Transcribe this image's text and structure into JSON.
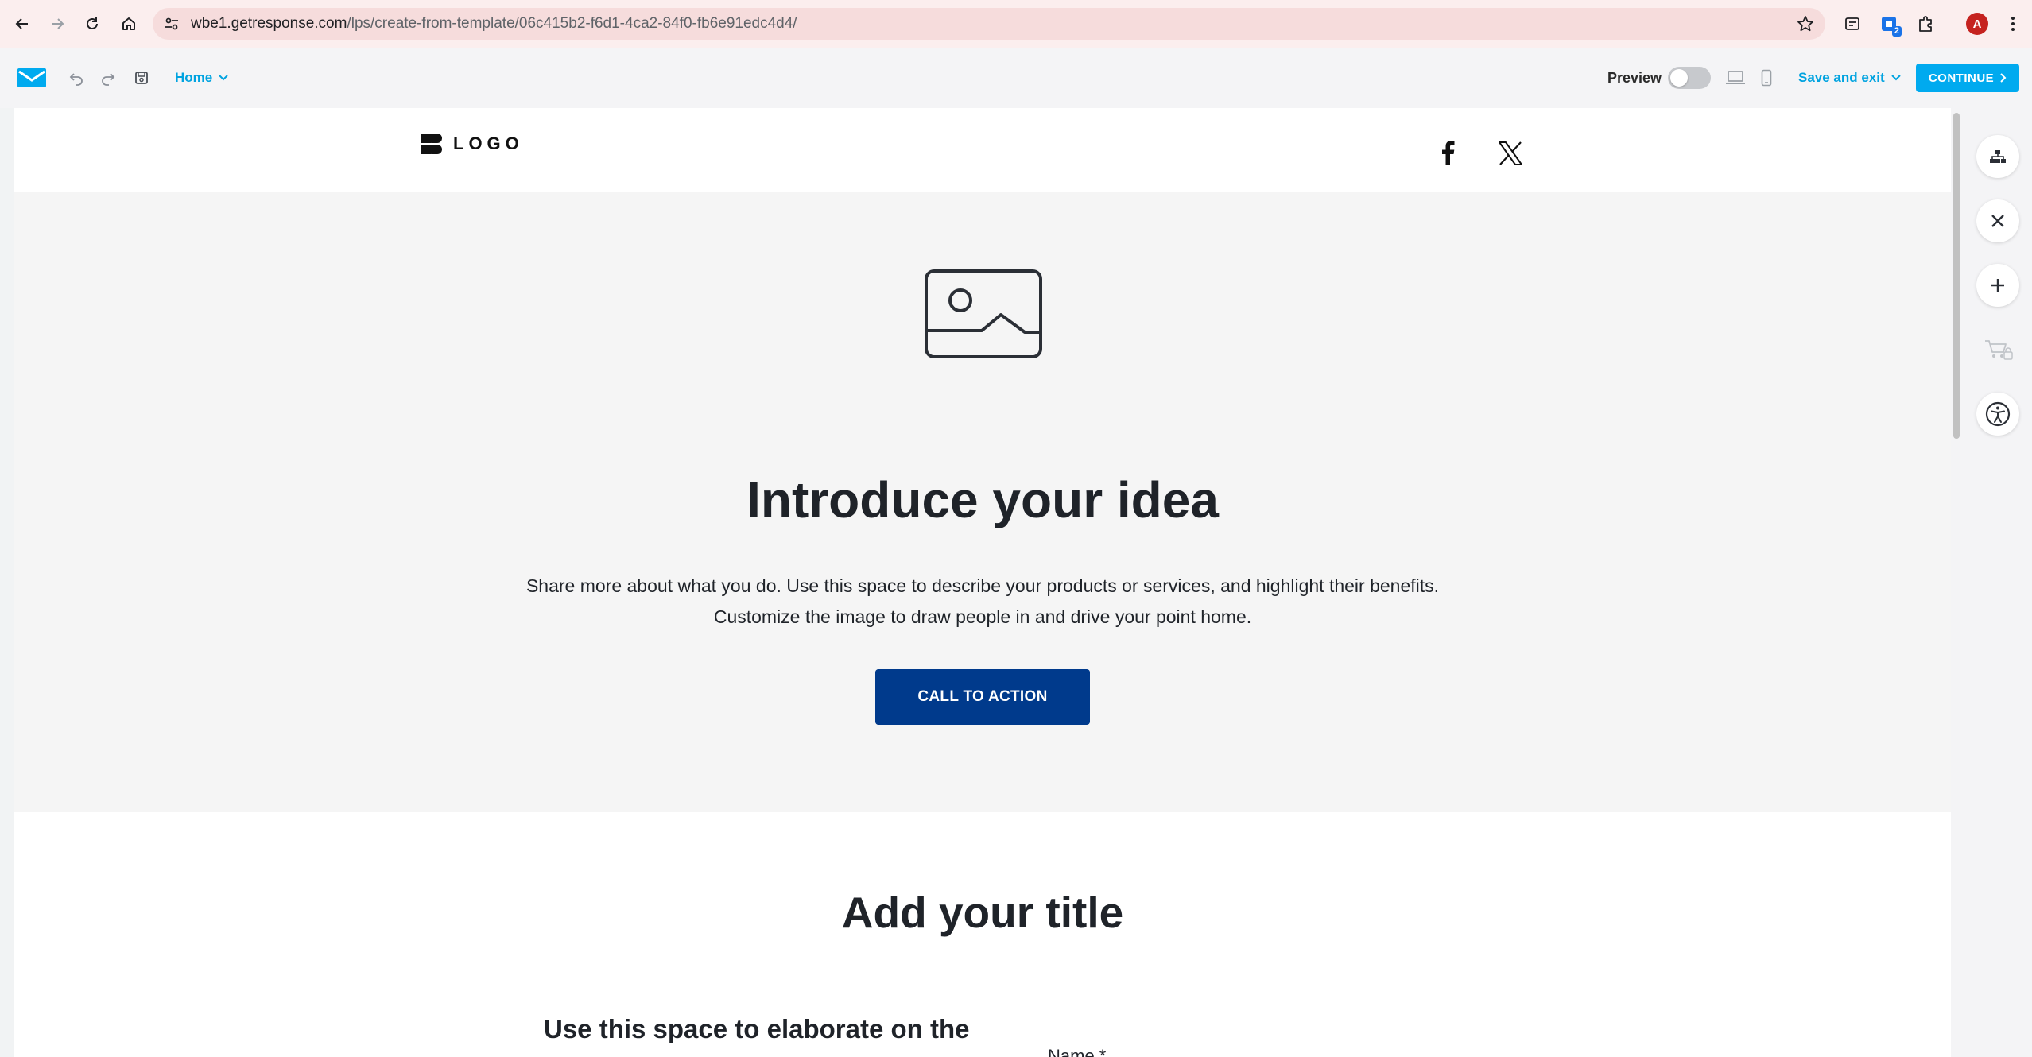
{
  "browser": {
    "url_host": "wbe1.getresponse.com",
    "url_path": "/lps/create-from-template/06c415b2-f6d1-4ca2-84f0-fb6e91edc4d4/",
    "profile_initial": "A",
    "extension_badge": "2"
  },
  "toolbar": {
    "home_label": "Home",
    "preview_label": "Preview",
    "preview_enabled": false,
    "save_exit_label": "Save and exit",
    "continue_label": "CONTINUE"
  },
  "page": {
    "logo_text": "LOGO",
    "hero_title": "Introduce your idea",
    "hero_text_line1": "Share more about what you do. Use this space to describe your products or services, and highlight their benefits.",
    "hero_text_line2": "Customize the image to draw people in and drive your point home.",
    "cta_label": "CALL TO ACTION",
    "section2_title": "Add your title",
    "section2_subtitle": "Use this space to elaborate on the",
    "form_name_label": "Name *"
  },
  "colors": {
    "accent": "#00aaef",
    "cta": "#003a8c",
    "hero_bg": "#f5f5f5",
    "text": "#1f2329"
  },
  "icons": {
    "browser": [
      "back-icon",
      "forward-icon",
      "reload-icon",
      "home-icon",
      "site-settings-icon",
      "bookmark-star-icon",
      "extension-icon",
      "puzzle-icon",
      "kebab-menu-icon"
    ],
    "toolbar": [
      "getresponse-logo-icon",
      "undo-icon",
      "redo-icon",
      "save-icon",
      "chevron-down-icon",
      "desktop-icon",
      "mobile-icon",
      "chevron-right-icon"
    ],
    "rail": [
      "sitemap-icon",
      "close-icon",
      "plus-icon",
      "cart-lock-icon",
      "accessibility-icon"
    ],
    "page": [
      "image-placeholder-icon",
      "facebook-icon",
      "x-twitter-icon"
    ]
  }
}
